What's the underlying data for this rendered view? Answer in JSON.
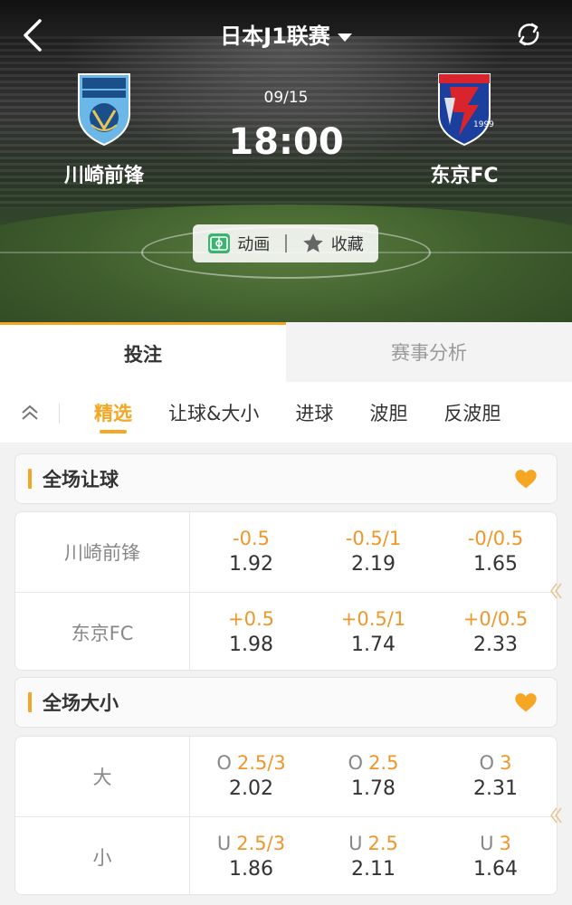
{
  "header": {
    "league": "日本J1联赛",
    "date": "09/15",
    "time": "18:00",
    "home_team": "川崎前锋",
    "away_team": "东京FC",
    "actions": {
      "animation": "动画",
      "favorite": "收藏"
    }
  },
  "main_tabs": [
    "投注",
    "赛事分析"
  ],
  "sub_tabs": [
    "精选",
    "让球&大小",
    "进球",
    "波胆",
    "反波胆"
  ],
  "sections": {
    "handicap": {
      "title": "全场让球",
      "rows": [
        {
          "label": "川崎前锋",
          "cells": [
            {
              "line": "-0.5",
              "odd": "1.92"
            },
            {
              "line": "-0.5/1",
              "odd": "2.19"
            },
            {
              "line": "-0/0.5",
              "odd": "1.65"
            }
          ]
        },
        {
          "label": "东京FC",
          "cells": [
            {
              "line": "+0.5",
              "odd": "1.98"
            },
            {
              "line": "+0.5/1",
              "odd": "1.74"
            },
            {
              "line": "+0/0.5",
              "odd": "2.33"
            }
          ]
        }
      ]
    },
    "totals": {
      "title": "全场大小",
      "rows": [
        {
          "label": "大",
          "cells": [
            {
              "prefix": "O",
              "line": "2.5/3",
              "odd": "2.02"
            },
            {
              "prefix": "O",
              "line": "2.5",
              "odd": "1.78"
            },
            {
              "prefix": "O",
              "line": "3",
              "odd": "2.31"
            }
          ]
        },
        {
          "label": "小",
          "cells": [
            {
              "prefix": "U",
              "line": "2.5/3",
              "odd": "1.86"
            },
            {
              "prefix": "U",
              "line": "2.5",
              "odd": "2.11"
            },
            {
              "prefix": "U",
              "line": "3",
              "odd": "1.64"
            }
          ]
        }
      ]
    }
  },
  "colors": {
    "accent": "#f5a623",
    "odds_line": "#f0962b"
  },
  "icons": [
    "back-icon",
    "dropdown-caret-icon",
    "refresh-icon",
    "home-team-logo",
    "away-team-logo",
    "animation-icon",
    "star-icon",
    "collapse-chevrons-icon",
    "heart-icon",
    "scroll-left-arrow-icon"
  ]
}
